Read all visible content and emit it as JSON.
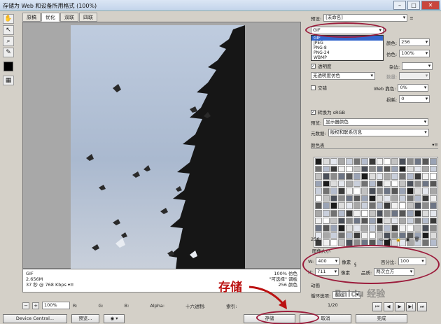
{
  "window": {
    "title": "存储为 Web 和设备所用格式 (100%)"
  },
  "tabs": [
    "原稿",
    "优化",
    "双联",
    "四联"
  ],
  "active_tab": 1,
  "info": {
    "format": "GIF",
    "size": "2.656M",
    "time": "37 秒 @ 768 Kbps",
    "right1": "100% 仿色",
    "right2": "\"可选择\" 调板",
    "right3": "256 颜色"
  },
  "zoom": {
    "value": "100%",
    "r": "R:",
    "g": "G:",
    "b": "B:",
    "alpha": "Alpha:",
    "hex": "十六进制:",
    "index": "索引:"
  },
  "bottom": {
    "device_central": "Device Central...",
    "preview": "预览...",
    "save": "存储",
    "cancel": "取消",
    "done": "完成"
  },
  "settings": {
    "preset_label": "预设:",
    "preset_value": "[未命名]",
    "format_value": "GIF",
    "format_options": [
      "GIF",
      "JPEG",
      "PNG-8",
      "PNG-24",
      "WBMP"
    ],
    "colors_label": "颜色:",
    "colors_value": "256",
    "dither_label": "仿色:",
    "dither_value": "100%",
    "matte_label": "杂边:",
    "transparency_label": "透明度",
    "no_transparency_dither": "无透明度仿色",
    "amount_label": "数量:",
    "interlaced_label": "交错",
    "web_snap_label": "Web 靠色:",
    "web_snap_value": "0%",
    "lossy_label": "损耗:",
    "lossy_value": "0",
    "convert_srgb": "转换为 sRGB",
    "preview_label": "预览:",
    "preview_value": "显示器颜色",
    "metadata_label": "元数据:",
    "metadata_value": "版权和联系信息",
    "color_table_label": "颜色表",
    "palette_count": "256",
    "image_size_label": "图像大小",
    "w_label": "W:",
    "w_value": "400",
    "h_label": "H:",
    "h_value": "711",
    "unit": "像素",
    "percent_label": "百分比:",
    "percent_value": "100",
    "quality_label": "品质:",
    "quality_value": "两次立方",
    "animation_label": "动画",
    "loop_label": "循环选项:",
    "loop_value": "永远",
    "frame_counter": "1/20"
  },
  "annotation": {
    "save_text": "存储"
  },
  "watermark": "Baidu 经验"
}
